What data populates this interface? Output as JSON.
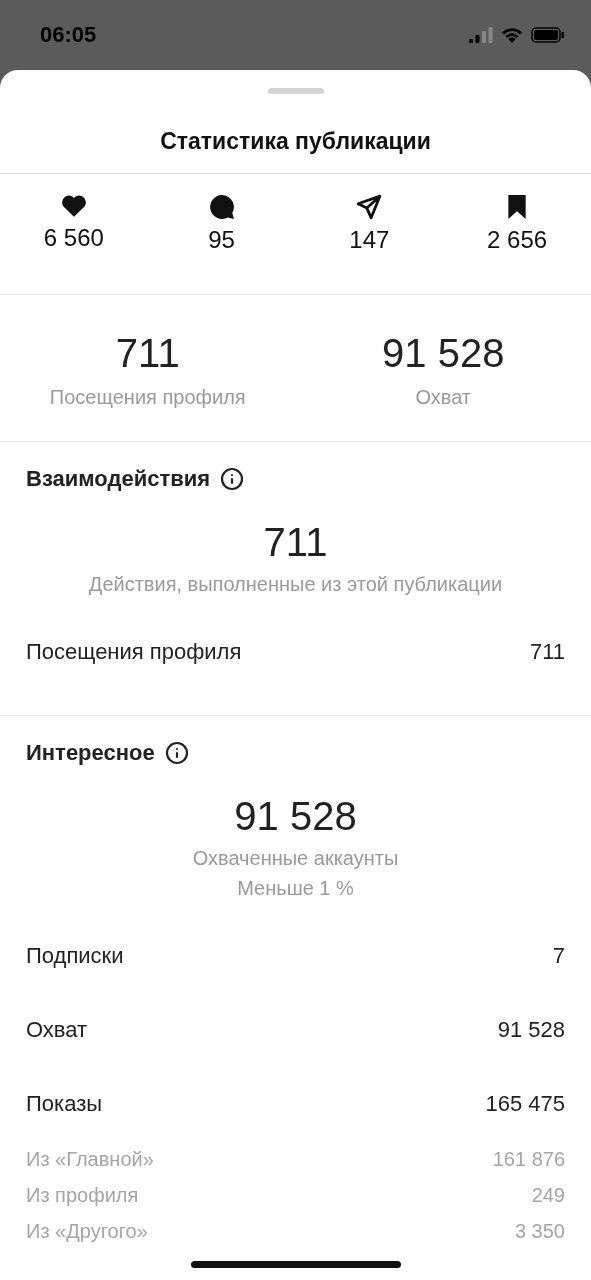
{
  "status_bar": {
    "time": "06:05"
  },
  "sheet": {
    "title": "Статистика публикации"
  },
  "post_stats": [
    {
      "kind": "likes",
      "value": "6 560"
    },
    {
      "kind": "comments",
      "value": "95"
    },
    {
      "kind": "shares",
      "value": "147"
    },
    {
      "kind": "saves",
      "value": "2 656"
    }
  ],
  "summary": [
    {
      "value": "711",
      "label": "Посещения профиля"
    },
    {
      "value": "91 528",
      "label": "Охват"
    }
  ],
  "sections": [
    {
      "title": "Взаимодействия",
      "total": "711",
      "captions": [
        "Действия, выполненные из этой публикации"
      ],
      "rows": [
        {
          "kind": "main",
          "label": "Посещения профиля",
          "value": "711"
        }
      ]
    },
    {
      "title": "Интересное",
      "total": "91 528",
      "captions": [
        "Охваченные аккаунты",
        "Меньше 1 %"
      ],
      "rows": [
        {
          "kind": "main",
          "label": "Подписки",
          "value": "7"
        },
        {
          "kind": "main",
          "label": "Охват",
          "value": "91 528"
        },
        {
          "kind": "main",
          "label": "Показы",
          "value": "165 475"
        },
        {
          "kind": "sub",
          "label": "Из «Главной»",
          "value": "161 876"
        },
        {
          "kind": "sub",
          "label": "Из профиля",
          "value": "249"
        },
        {
          "kind": "sub",
          "label": "Из «Другого»",
          "value": "3 350"
        }
      ]
    }
  ]
}
